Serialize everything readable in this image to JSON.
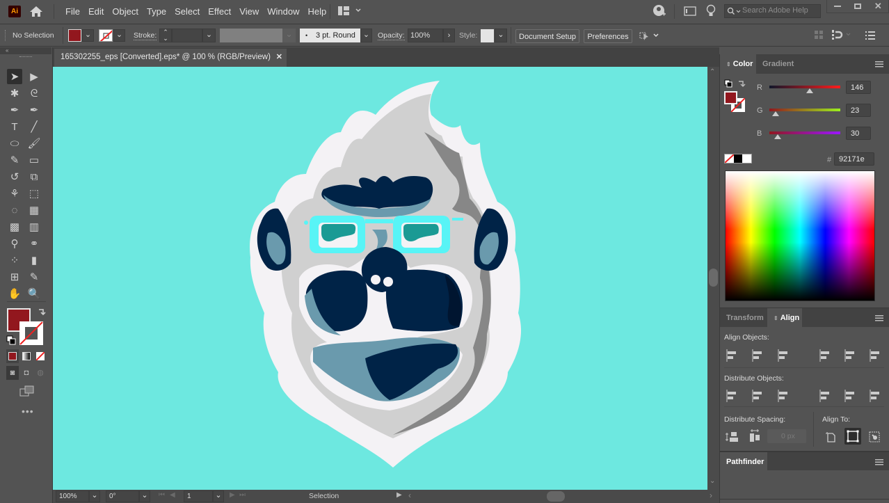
{
  "app": {
    "logo": "Ai",
    "name": "Adobe Illustrator"
  },
  "menubar": {
    "items": [
      "File",
      "Edit",
      "Object",
      "Type",
      "Select",
      "Effect",
      "View",
      "Window",
      "Help"
    ],
    "search_placeholder": "Search Adobe Help",
    "window_controls": [
      "minimize",
      "maximize",
      "close"
    ]
  },
  "options_bar": {
    "selection_label": "No Selection",
    "fill_color": "#92171e",
    "stroke_label": "Stroke:",
    "brush_label": "3 pt. Round",
    "opacity_label": "Opacity:",
    "opacity_value": "100%",
    "style_label": "Style:",
    "document_setup": "Document Setup",
    "preferences": "Preferences"
  },
  "document": {
    "tab_title": "165302255_eps [Converted].eps* @ 100 % (RGB/Preview)",
    "canvas_color": "#6de8e0"
  },
  "tools": [
    "selection-tool",
    "direct-selection-tool",
    "magic-wand-tool",
    "lasso-tool",
    "pen-tool",
    "curvature-tool",
    "type-tool",
    "line-tool",
    "ellipse-tool",
    "paintbrush-tool",
    "shaper-tool",
    "eraser-tool",
    "rotate-tool",
    "scale-tool",
    "puppet-warp-tool",
    "free-transform-tool",
    "shape-builder-tool",
    "perspective-grid-tool",
    "mesh-tool",
    "gradient-tool",
    "eyedropper-tool",
    "blend-tool",
    "symbol-sprayer-tool",
    "column-graph-tool",
    "artboard-tool",
    "slice-tool",
    "hand-tool",
    "zoom-tool"
  ],
  "tool_glyphs": [
    "➤",
    "▶",
    "✱",
    "ᘓ",
    "✒",
    "✒",
    "T",
    "╱",
    "⬭",
    "🖌",
    "✎",
    "▭",
    "↺",
    "⧉",
    "⚘",
    "⬚",
    "◌",
    "▦",
    "▩",
    "▥",
    "⚲",
    "⚭",
    "⁘",
    "▮",
    "⊞",
    "✎",
    "✋",
    "🔍"
  ],
  "status_bar": {
    "zoom": "100%",
    "rotation": "0°",
    "artboard": "1",
    "tool_status": "Selection"
  },
  "color_panel": {
    "tabs": [
      "Color",
      "Gradient"
    ],
    "active_tab": "Color",
    "channels": [
      {
        "label": "R",
        "value": "146",
        "fraction": 0.573
      },
      {
        "label": "G",
        "value": "23",
        "fraction": 0.09
      },
      {
        "label": "B",
        "value": "30",
        "fraction": 0.118
      }
    ],
    "hex_label": "#",
    "hex_value": "92171e",
    "fill_color": "#92171e"
  },
  "align_panel": {
    "tabs": [
      "Transform",
      "Align"
    ],
    "active_tab": "Align",
    "align_objects_label": "Align Objects:",
    "distribute_objects_label": "Distribute Objects:",
    "distribute_spacing_label": "Distribute Spacing:",
    "spacing_value": "0 px",
    "align_to_label": "Align To:"
  },
  "pathfinder_panel": {
    "tab": "Pathfinder"
  }
}
